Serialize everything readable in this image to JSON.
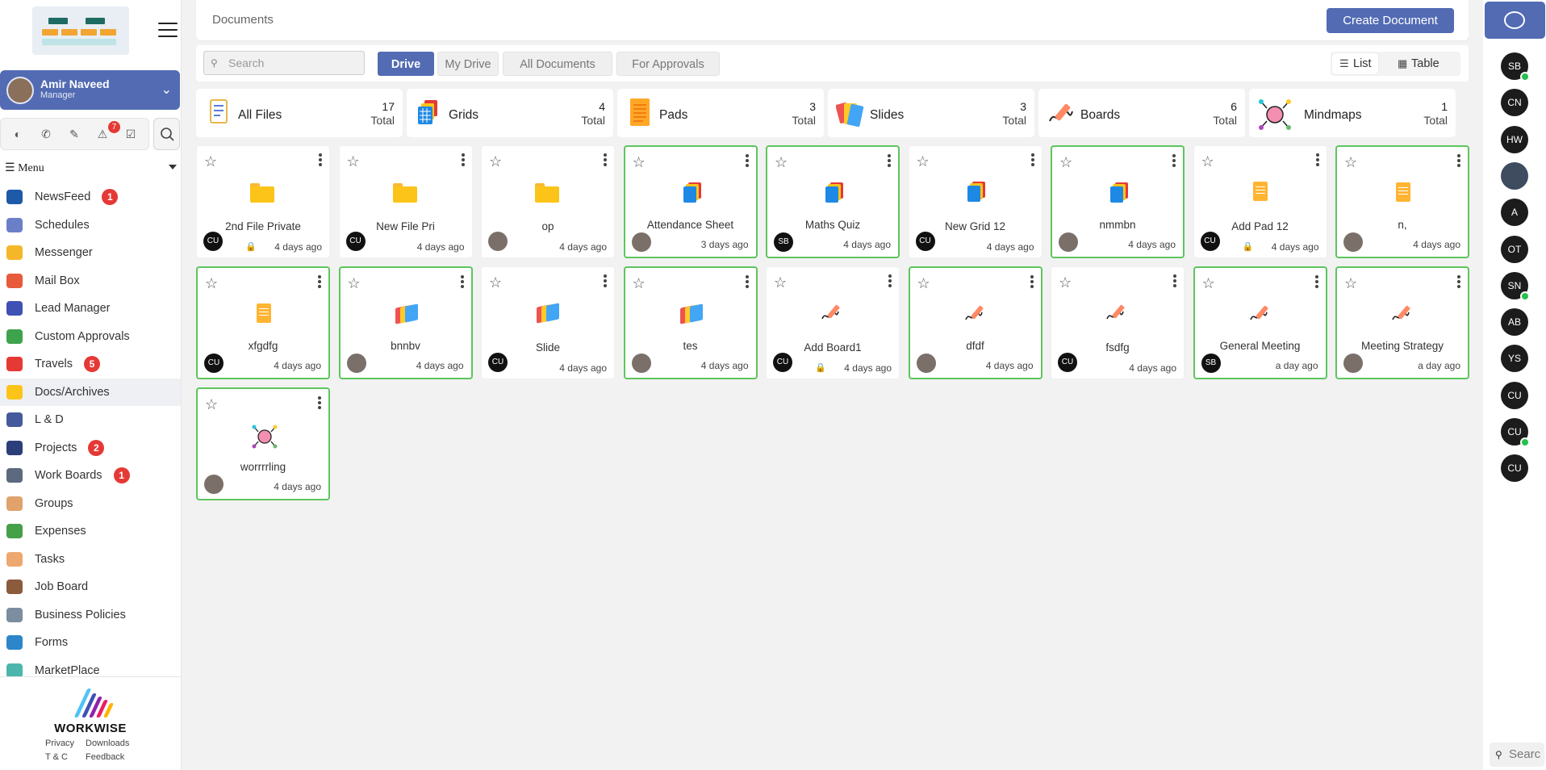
{
  "sidebar": {
    "user": {
      "name": "Amir Naveed",
      "role": "Manager"
    },
    "notification_count": "7",
    "menu_title": "Menu",
    "items": [
      {
        "label": "NewsFeed",
        "badge": "1",
        "color": "#1e5aa8"
      },
      {
        "label": "Schedules",
        "badge": "",
        "color": "#6b7fc9"
      },
      {
        "label": "Messenger",
        "badge": "",
        "color": "#f5b72a"
      },
      {
        "label": "Mail Box",
        "badge": "",
        "color": "#e85a3c"
      },
      {
        "label": "Lead Manager",
        "badge": "",
        "color": "#3f51b5"
      },
      {
        "label": "Custom Approvals",
        "badge": "",
        "color": "#3ea34d"
      },
      {
        "label": "Travels",
        "badge": "5",
        "color": "#e53935"
      },
      {
        "label": "Docs/Archives",
        "badge": "",
        "color": "#fcc419"
      },
      {
        "label": "L & D",
        "badge": "",
        "color": "#455a9a"
      },
      {
        "label": "Projects",
        "badge": "2",
        "color": "#2c3e7a"
      },
      {
        "label": "Work Boards",
        "badge": "1",
        "color": "#5b6a7f"
      },
      {
        "label": "Groups",
        "badge": "",
        "color": "#e0a36b"
      },
      {
        "label": "Expenses",
        "badge": "",
        "color": "#45a04a"
      },
      {
        "label": "Tasks",
        "badge": "",
        "color": "#eda86f"
      },
      {
        "label": "Job Board",
        "badge": "",
        "color": "#8c5a3c"
      },
      {
        "label": "Business Policies",
        "badge": "",
        "color": "#7b8d9e"
      },
      {
        "label": "Forms",
        "badge": "",
        "color": "#2d86c9"
      },
      {
        "label": "MarketPlace",
        "badge": "",
        "color": "#4db6ac"
      }
    ],
    "footer": {
      "brand": "WORKWISE",
      "links": [
        "Privacy",
        "Downloads",
        "T & C",
        "Feedback"
      ]
    }
  },
  "header": {
    "title": "Documents",
    "create_label": "Create Document"
  },
  "filters": {
    "search_placeholder": "Search",
    "tabs": [
      "Drive",
      "My Drive",
      "All Documents",
      "For Approvals"
    ],
    "view_list": "List",
    "view_table": "Table"
  },
  "stats": [
    {
      "name": "All Files",
      "count": "17",
      "total_label": "Total",
      "icon": "all-files-icon"
    },
    {
      "name": "Grids",
      "count": "4",
      "total_label": "Total",
      "icon": "grid-icon"
    },
    {
      "name": "Pads",
      "count": "3",
      "total_label": "Total",
      "icon": "pad-icon"
    },
    {
      "name": "Slides",
      "count": "3",
      "total_label": "Total",
      "icon": "slide-icon"
    },
    {
      "name": "Boards",
      "count": "6",
      "total_label": "Total",
      "icon": "board-icon"
    },
    {
      "name": "Mindmaps",
      "count": "1",
      "total_label": "Total",
      "icon": "mindmap-icon"
    }
  ],
  "documents": [
    {
      "name": "2nd File Private",
      "type": "folder",
      "owner": "CU",
      "date": "4 days ago",
      "locked": true,
      "highlighted": false
    },
    {
      "name": "New File Pri",
      "type": "folder",
      "owner": "CU",
      "date": "4 days ago",
      "locked": false,
      "highlighted": false
    },
    {
      "name": "op",
      "type": "folder",
      "owner": "",
      "date": "4 days ago",
      "locked": false,
      "highlighted": false
    },
    {
      "name": "Attendance Sheet",
      "type": "grid",
      "owner": "",
      "date": "3 days ago",
      "locked": false,
      "highlighted": true
    },
    {
      "name": "Maths Quiz",
      "type": "grid",
      "owner": "SB",
      "date": "4 days ago",
      "locked": false,
      "highlighted": true
    },
    {
      "name": "New Grid 12",
      "type": "grid",
      "owner": "CU",
      "date": "4 days ago",
      "locked": false,
      "highlighted": false
    },
    {
      "name": "nmmbn",
      "type": "grid",
      "owner": "",
      "date": "4 days ago",
      "locked": false,
      "highlighted": true
    },
    {
      "name": "Add Pad 12",
      "type": "pad",
      "owner": "CU",
      "date": "4 days ago",
      "locked": true,
      "highlighted": false
    },
    {
      "name": "n,",
      "type": "pad",
      "owner": "",
      "date": "4 days ago",
      "locked": false,
      "highlighted": true
    },
    {
      "name": "xfgdfg",
      "type": "pad",
      "owner": "CU",
      "date": "4 days ago",
      "locked": false,
      "highlighted": true
    },
    {
      "name": "bnnbv",
      "type": "slide",
      "owner": "",
      "date": "4 days ago",
      "locked": false,
      "highlighted": true
    },
    {
      "name": "Slide",
      "type": "slide",
      "owner": "CU",
      "date": "4 days ago",
      "locked": false,
      "highlighted": false
    },
    {
      "name": "tes",
      "type": "slide",
      "owner": "",
      "date": "4 days ago",
      "locked": false,
      "highlighted": true
    },
    {
      "name": "Add Board1",
      "type": "board",
      "owner": "CU",
      "date": "4 days ago",
      "locked": true,
      "highlighted": false
    },
    {
      "name": "dfdf",
      "type": "board",
      "owner": "",
      "date": "4 days ago",
      "locked": false,
      "highlighted": true
    },
    {
      "name": "fsdfg",
      "type": "board",
      "owner": "CU",
      "date": "4 days ago",
      "locked": false,
      "highlighted": false
    },
    {
      "name": "General Meeting",
      "type": "board",
      "owner": "SB",
      "date": "a day ago",
      "locked": false,
      "highlighted": true
    },
    {
      "name": "Meeting Strategy",
      "type": "board",
      "owner": "",
      "date": "a day ago",
      "locked": false,
      "highlighted": true
    },
    {
      "name": "worrrrling",
      "type": "mindmap",
      "owner": "",
      "date": "4 days ago",
      "locked": false,
      "highlighted": true
    }
  ],
  "rail": {
    "contacts": [
      {
        "initials": "SB",
        "online": true
      },
      {
        "initials": "CN",
        "online": false
      },
      {
        "initials": "HW",
        "online": false
      },
      {
        "initials": "",
        "online": false
      },
      {
        "initials": "A",
        "online": false
      },
      {
        "initials": "OT",
        "online": false
      },
      {
        "initials": "SN",
        "online": true
      },
      {
        "initials": "AB",
        "online": false
      },
      {
        "initials": "YS",
        "online": false
      },
      {
        "initials": "CU",
        "online": false
      },
      {
        "initials": "CU",
        "online": true
      },
      {
        "initials": "CU",
        "online": false
      }
    ],
    "search_text": "Searc"
  },
  "colors": {
    "accent": "#526bb3",
    "highlight_border": "#5dc55d",
    "badge": "#e53935"
  }
}
